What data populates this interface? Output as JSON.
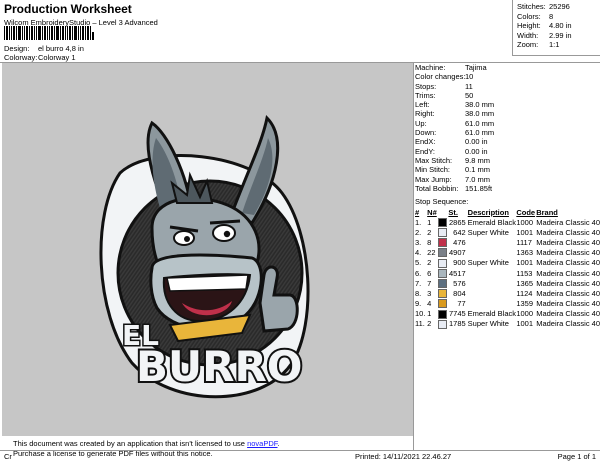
{
  "header": {
    "title": "Production Worksheet",
    "subtitle": "Wilcom EmbroideryStudio – Level 3 Advanced",
    "design_label": "Design:",
    "design_value": "el burro 4,8 in",
    "colorway_label": "Colorway:",
    "colorway_value": "Colorway 1"
  },
  "stats": [
    {
      "k": "Stitches:",
      "v": "25296"
    },
    {
      "k": "Colors:",
      "v": "8"
    },
    {
      "k": "Height:",
      "v": "4.80 in"
    },
    {
      "k": "Width:",
      "v": "2.99 in"
    },
    {
      "k": "Zoom:",
      "v": "1:1"
    }
  ],
  "machine": [
    {
      "k": "Machine:",
      "v": "Tajima"
    },
    {
      "k": "Color changes:",
      "v": "10"
    },
    {
      "k": "Stops:",
      "v": "11"
    },
    {
      "k": "Trims:",
      "v": "50"
    },
    {
      "k": "Left:",
      "v": "38.0 mm"
    },
    {
      "k": "Right:",
      "v": "38.0 mm"
    },
    {
      "k": "Up:",
      "v": "61.0 mm"
    },
    {
      "k": "Down:",
      "v": "61.0 mm"
    },
    {
      "k": "EndX:",
      "v": "0.00 in"
    },
    {
      "k": "EndY:",
      "v": "0.00 in"
    },
    {
      "k": "Max Stitch:",
      "v": "9.8 mm"
    },
    {
      "k": "Min Stitch:",
      "v": "0.1 mm"
    },
    {
      "k": "Max Jump:",
      "v": "7.0 mm"
    },
    {
      "k": "Total Bobbin:",
      "v": "151.85ft"
    }
  ],
  "sequence": {
    "title": "Stop Sequence:",
    "columns": [
      "#",
      "N#",
      "St.",
      "Description",
      "Code",
      "Brand"
    ],
    "rows": [
      {
        "n": "1.",
        "nn": "1",
        "color": "#000000",
        "st": "2865",
        "desc": "Emerald Black",
        "code": "1000",
        "brand": "Madeira Classic 40"
      },
      {
        "n": "2.",
        "nn": "2",
        "color": "#e8ecf4",
        "st": "642",
        "desc": "Super White",
        "code": "1001",
        "brand": "Madeira Classic 40"
      },
      {
        "n": "3.",
        "nn": "8",
        "color": "#c0304a",
        "st": "476",
        "desc": "",
        "code": "1117",
        "brand": "Madeira Classic 40"
      },
      {
        "n": "4.",
        "nn": "22",
        "color": "#7a8088",
        "st": "4907",
        "desc": "",
        "code": "1363",
        "brand": "Madeira Classic 40"
      },
      {
        "n": "5.",
        "nn": "2",
        "color": "#e8ecf4",
        "st": "900",
        "desc": "Super White",
        "code": "1001",
        "brand": "Madeira Classic 40"
      },
      {
        "n": "6.",
        "nn": "6",
        "color": "#a9b6bd",
        "st": "4517",
        "desc": "",
        "code": "1153",
        "brand": "Madeira Classic 40"
      },
      {
        "n": "7.",
        "nn": "7",
        "color": "#5c6f80",
        "st": "576",
        "desc": "",
        "code": "1365",
        "brand": "Madeira Classic 40"
      },
      {
        "n": "8.",
        "nn": "3",
        "color": "#e9b53a",
        "st": "804",
        "desc": "",
        "code": "1124",
        "brand": "Madeira Classic 40"
      },
      {
        "n": "9.",
        "nn": "4",
        "color": "#d99a1e",
        "st": "77",
        "desc": "",
        "code": "1359",
        "brand": "Madeira Classic 40"
      },
      {
        "n": "10.",
        "nn": "1",
        "color": "#000000",
        "st": "7745",
        "desc": "Emerald Black",
        "code": "1000",
        "brand": "Madeira Classic 40"
      },
      {
        "n": "11.",
        "nn": "2",
        "color": "#e8ecf4",
        "st": "1785",
        "desc": "Super White",
        "code": "1001",
        "brand": "Madeira Classic 40"
      }
    ]
  },
  "logo": {
    "word1": "EL",
    "word2": "BURRO"
  },
  "notice": {
    "line1_pre": "This document was created by an application that isn't licensed to use ",
    "link": "novaPDF",
    "line1_post": ".",
    "line2": "Purchase a license to generate PDF files without this notice."
  },
  "footer": {
    "left": "Cr",
    "printed": "Printed: 14/11/2021 22.46.27",
    "page": "Page 1 of 1"
  }
}
